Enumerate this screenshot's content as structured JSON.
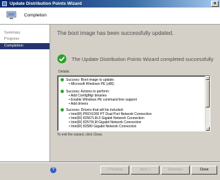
{
  "window": {
    "title": "Update Distribution Points Wizard"
  },
  "header": {
    "title": "Completion"
  },
  "sidebar": {
    "items": [
      {
        "label": "Summary",
        "active": false
      },
      {
        "label": "Progress",
        "active": false
      },
      {
        "label": "Completion",
        "active": true
      }
    ]
  },
  "main": {
    "status_top": "The boot image has been successfully updated.",
    "completed_message": "The Update Distribution Points Wizard completed successfully",
    "details_label": "Details:",
    "sections": [
      {
        "heading": "Success: Boot image to update:",
        "lines": [
          "• Microsoft Windows PE (x86)"
        ]
      },
      {
        "heading": "Success: Actions to perform:",
        "lines": [
          "• Add ConfigMgr binaries",
          "• Enable Windows PE command line support",
          "• Add drivers"
        ]
      },
      {
        "heading": "Success: Drivers that will be included:",
        "lines": [
          "• Intel(R) PRO/1000 PT Dual Port Network Connection",
          "• Intel(R) 82567LM-3 Gigabit Network Connection",
          "• Intel(R) 82579LM Gigabit Network Connection",
          "• Intel(R) 82580 Gigabit Network Connection"
        ]
      }
    ],
    "exit_text": "To exit the wizard, click Close."
  },
  "buttons": {
    "previous": "< Previous",
    "next": "Next >",
    "summary": "Summary",
    "close": "Close",
    "close_icon": "×",
    "help_icon": "?"
  },
  "colors": {
    "title_bar": "#0a246a",
    "sidebar_active": "#26346e",
    "success_green": "#2aa02a"
  }
}
